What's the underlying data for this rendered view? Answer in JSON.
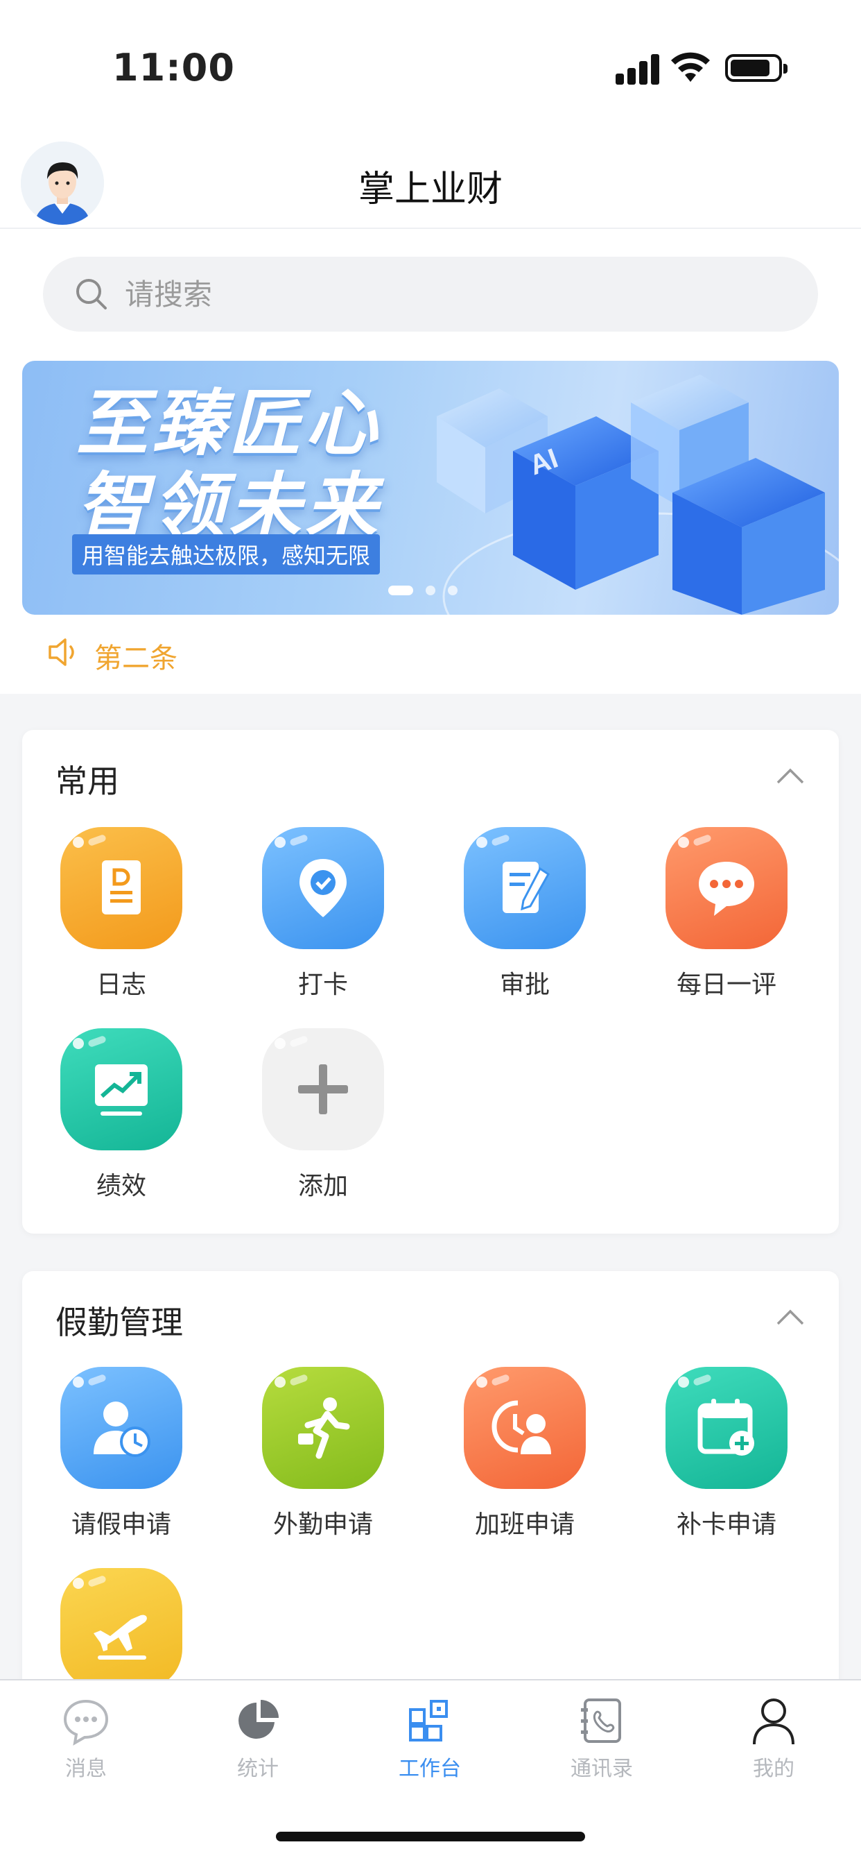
{
  "status_bar": {
    "time": "11:00"
  },
  "header": {
    "title": "掌上业财"
  },
  "search": {
    "placeholder": "请搜索"
  },
  "banner": {
    "headline_line1": "至臻匠心",
    "headline_line2": "智领未来",
    "subtitle": "用智能去触达极限，感知无限",
    "dots": 3,
    "active_dot": 0
  },
  "notice": {
    "text": "第二条"
  },
  "sections": [
    {
      "title": "常用",
      "apps": [
        {
          "label": "日志",
          "icon": "log-icon",
          "color": "#f8a92a"
        },
        {
          "label": "打卡",
          "icon": "checkin-icon",
          "color": "#4ca3f3"
        },
        {
          "label": "审批",
          "icon": "approval-icon",
          "color": "#4ca3f3"
        },
        {
          "label": "每日一评",
          "icon": "chat-icon",
          "color": "#f7774a"
        },
        {
          "label": "绩效",
          "icon": "performance-icon",
          "color": "#1ec7a8"
        },
        {
          "label": "添加",
          "icon": "plus-icon",
          "color": "#f1f1f1"
        }
      ]
    },
    {
      "title": "假勤管理",
      "apps": [
        {
          "label": "请假申请",
          "icon": "leave-icon",
          "color": "#4ca3f3"
        },
        {
          "label": "外勤申请",
          "icon": "field-work-icon",
          "color": "#9ccc2a"
        },
        {
          "label": "加班申请",
          "icon": "overtime-icon",
          "color": "#f7774a"
        },
        {
          "label": "补卡申请",
          "icon": "makeup-card-icon",
          "color": "#1ec7a8"
        },
        {
          "label": "",
          "icon": "business-trip-icon",
          "color": "#f6c83a"
        }
      ]
    }
  ],
  "tabbar": {
    "items": [
      {
        "label": "消息",
        "icon": "message-icon",
        "active": false
      },
      {
        "label": "统计",
        "icon": "statistics-icon",
        "active": false
      },
      {
        "label": "工作台",
        "icon": "workbench-icon",
        "active": true
      },
      {
        "label": "通讯录",
        "icon": "contacts-icon",
        "active": false
      },
      {
        "label": "我的",
        "icon": "profile-icon",
        "active": false
      }
    ]
  }
}
